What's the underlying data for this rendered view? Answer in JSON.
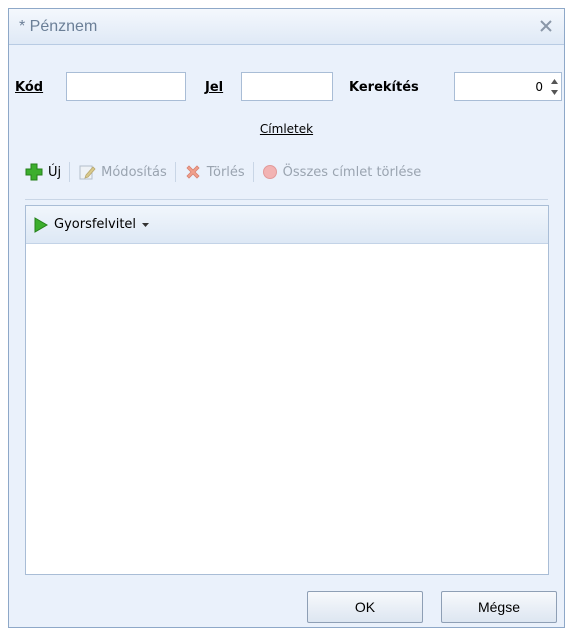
{
  "window": {
    "title": "* Pénznem"
  },
  "form": {
    "code_label": "Kód",
    "code_value": "",
    "sign_label": "Jel",
    "sign_value": "",
    "rounding_label": "Kerekítés",
    "rounding_value": "0"
  },
  "denominations": {
    "section_label": "Címletek",
    "toolbar": {
      "new_label": "Új",
      "edit_label": "Módosítás",
      "delete_label": "Törlés",
      "delete_all_label": "Összes címlet törlése"
    },
    "quick_entry_label": "Gyorsfelvitel",
    "rows": []
  },
  "buttons": {
    "ok_label": "OK",
    "cancel_label": "Mégse"
  },
  "colors": {
    "window_bg": "#eaf1fb",
    "border": "#a9bdd6",
    "accent_green": "#3cae2d"
  }
}
